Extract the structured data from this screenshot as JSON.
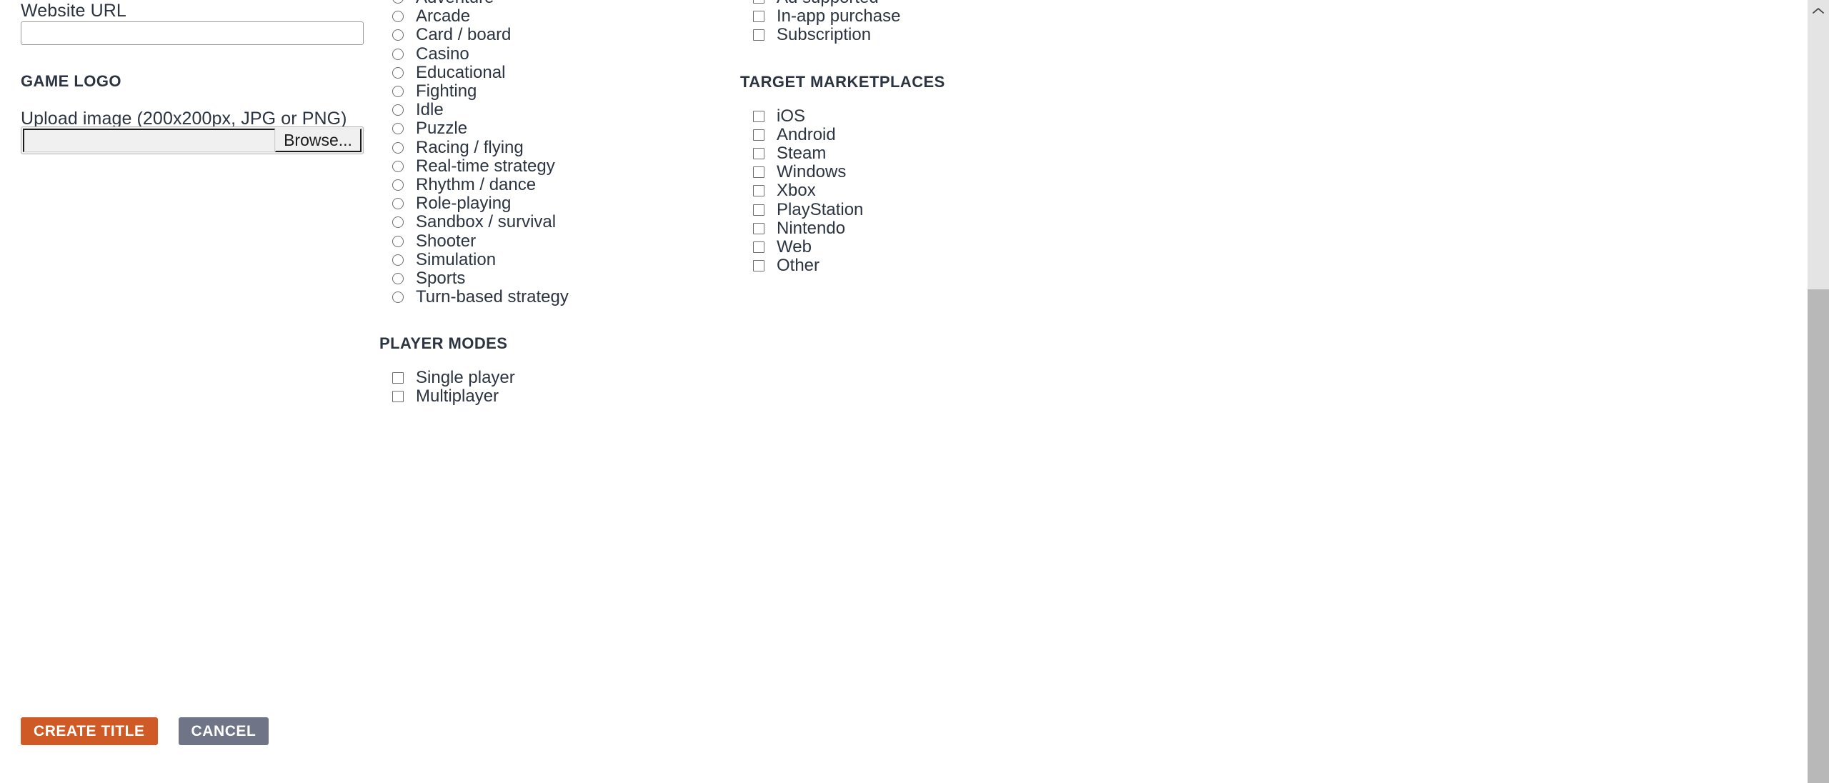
{
  "form": {
    "website_url": {
      "label": "Website URL",
      "value": "",
      "placeholder": ""
    },
    "game_logo": {
      "section_heading": "GAME LOGO",
      "upload_label": "Upload image (200x200px, JPG or PNG)",
      "file_path_value": "",
      "browse_label": "Browse..."
    }
  },
  "genres": {
    "options": [
      {
        "label": "Adventure",
        "checked": false
      },
      {
        "label": "Arcade",
        "checked": false
      },
      {
        "label": "Card / board",
        "checked": false
      },
      {
        "label": "Casino",
        "checked": false
      },
      {
        "label": "Educational",
        "checked": false
      },
      {
        "label": "Fighting",
        "checked": false
      },
      {
        "label": "Idle",
        "checked": false
      },
      {
        "label": "Puzzle",
        "checked": false
      },
      {
        "label": "Racing / flying",
        "checked": false
      },
      {
        "label": "Real-time strategy",
        "checked": false
      },
      {
        "label": "Rhythm / dance",
        "checked": false
      },
      {
        "label": "Role-playing",
        "checked": false
      },
      {
        "label": "Sandbox / survival",
        "checked": false
      },
      {
        "label": "Shooter",
        "checked": false
      },
      {
        "label": "Simulation",
        "checked": false
      },
      {
        "label": "Sports",
        "checked": false
      },
      {
        "label": "Turn-based strategy",
        "checked": false
      }
    ]
  },
  "player_modes": {
    "heading": "PLAYER MODES",
    "options": [
      {
        "label": "Single player",
        "checked": false
      },
      {
        "label": "Multiplayer",
        "checked": false
      }
    ]
  },
  "monetization": {
    "options": [
      {
        "label": "Ad supported",
        "checked": false
      },
      {
        "label": "In-app purchase",
        "checked": false
      },
      {
        "label": "Subscription",
        "checked": false
      }
    ]
  },
  "target_marketplaces": {
    "heading": "TARGET MARKETPLACES",
    "options": [
      {
        "label": "iOS",
        "checked": false
      },
      {
        "label": "Android",
        "checked": false
      },
      {
        "label": "Steam",
        "checked": false
      },
      {
        "label": "Windows",
        "checked": false
      },
      {
        "label": "Xbox",
        "checked": false
      },
      {
        "label": "PlayStation",
        "checked": false
      },
      {
        "label": "Nintendo",
        "checked": false
      },
      {
        "label": "Web",
        "checked": false
      },
      {
        "label": "Other",
        "checked": false
      }
    ]
  },
  "actions": {
    "primary_label": "CREATE TITLE",
    "secondary_label": "CANCEL"
  },
  "colors": {
    "primary_button": "#cf5a26",
    "secondary_button": "#6f7586",
    "text": "#2b3440",
    "input_border": "#9a9a9a",
    "scrollbar_track": "#e4e4e4",
    "scrollbar_thumb": "#b8b8b8"
  },
  "scrollbar": {
    "up_arrow_icon": "chevron-up-icon"
  }
}
